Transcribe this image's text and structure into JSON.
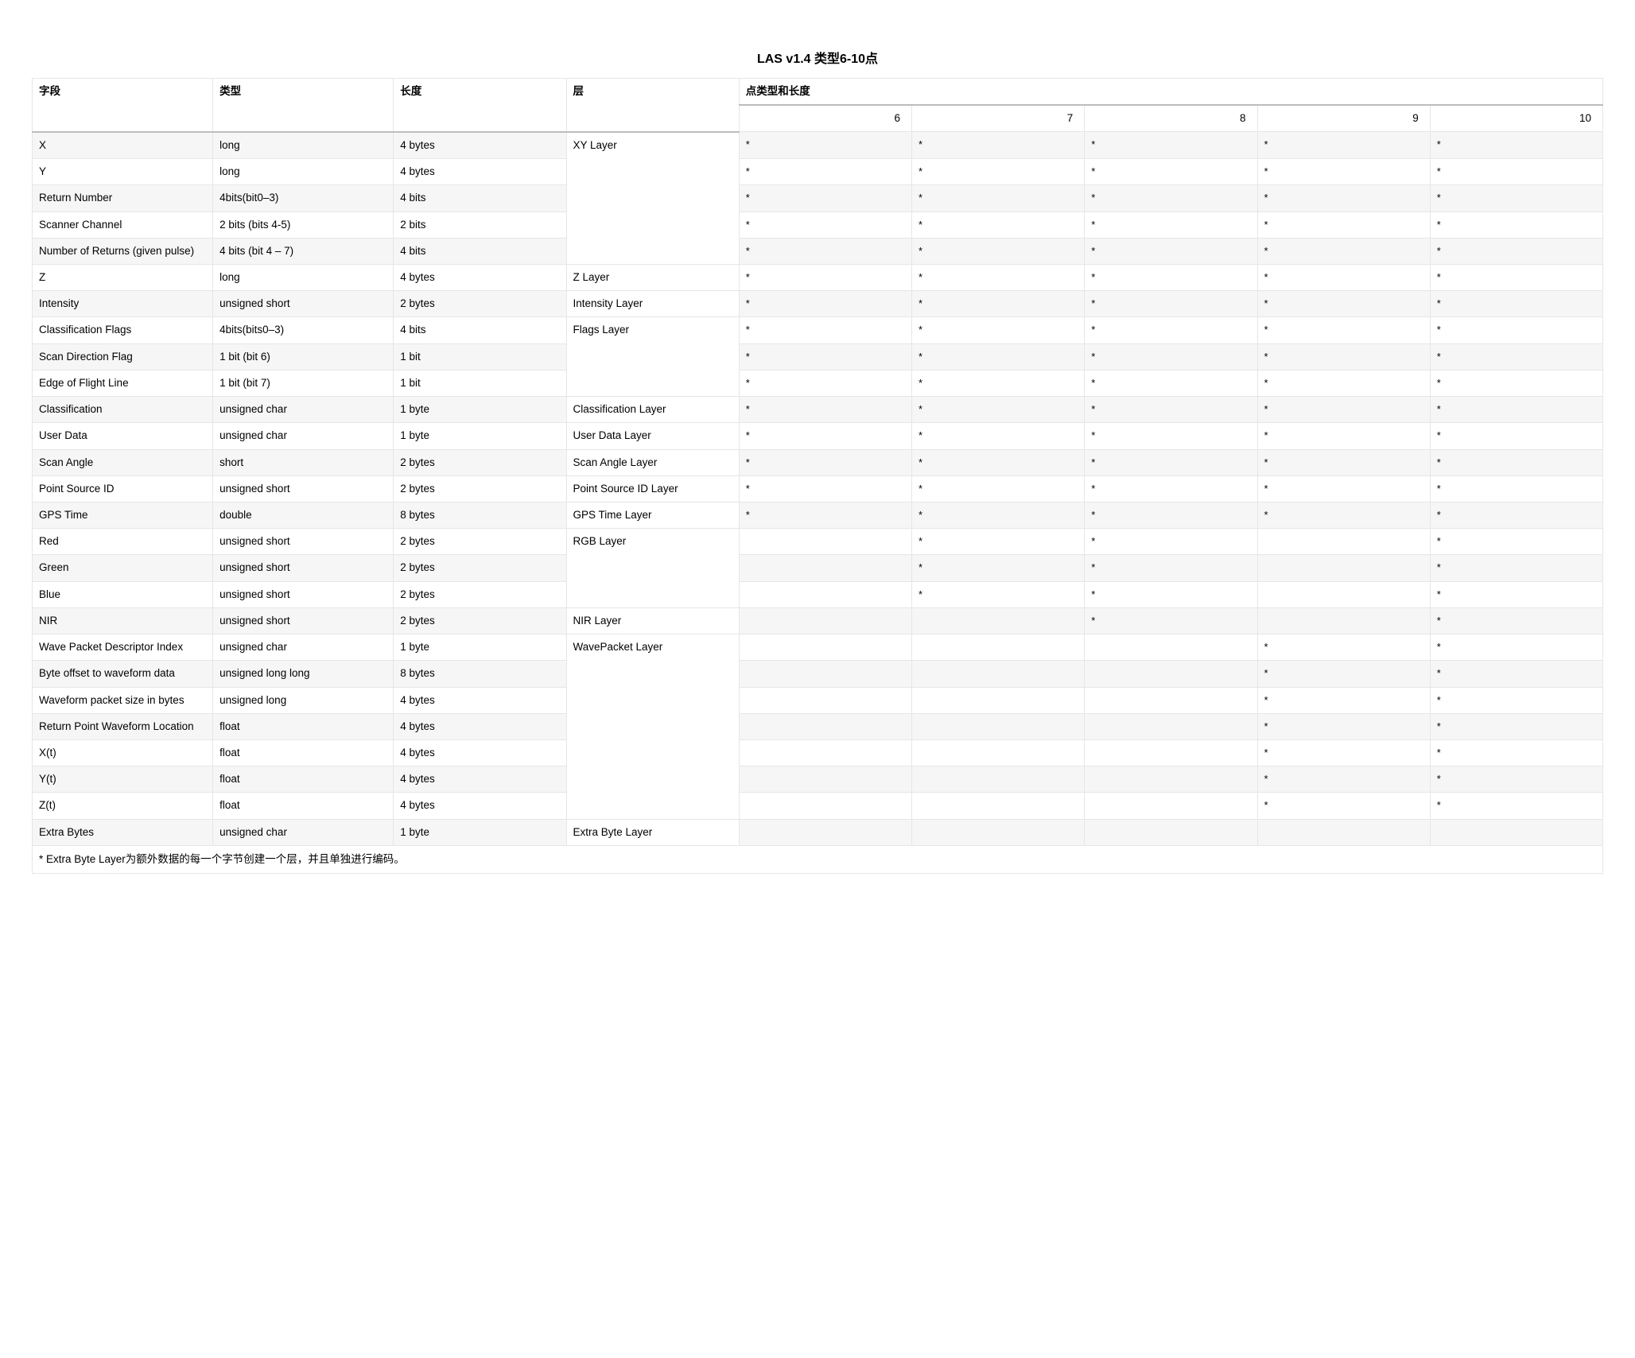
{
  "title": "LAS v1.4 类型6-10点",
  "headers": {
    "field": "字段",
    "type": "类型",
    "length": "长度",
    "layer": "层",
    "point_group": "点类型和长度"
  },
  "point_types": [
    "6",
    "7",
    "8",
    "9",
    "10"
  ],
  "layers": {
    "xy": "XY Layer",
    "z": "Z Layer",
    "intensity": "Intensity Layer",
    "flags": "Flags Layer",
    "classification": "Classification Layer",
    "userdata": "User Data Layer",
    "scanangle": "Scan Angle Layer",
    "pointsource": "Point Source ID Layer",
    "gpstime": "GPS Time Layer",
    "rgb": "RGB Layer",
    "nir": "NIR Layer",
    "wavepacket": "WavePacket Layer",
    "extrabyte": "Extra Byte Layer"
  },
  "rows": [
    {
      "field": "X",
      "type": "long",
      "length": "4 bytes",
      "layer_key": "xy",
      "layer_span": 5,
      "pts": [
        "*",
        "*",
        "*",
        "*",
        "*"
      ]
    },
    {
      "field": "Y",
      "type": "long",
      "length": "4 bytes",
      "pts": [
        "*",
        "*",
        "*",
        "*",
        "*"
      ]
    },
    {
      "field": "Return Number",
      "type": "4bits(bit0–3)",
      "length": "4 bits",
      "pts": [
        "*",
        "*",
        "*",
        "*",
        "*"
      ]
    },
    {
      "field": "Scanner Channel",
      "type": "2 bits (bits 4-5)",
      "length": "2 bits",
      "pts": [
        "*",
        "*",
        "*",
        "*",
        "*"
      ]
    },
    {
      "field": "Number of Returns (given pulse)",
      "type": "4 bits (bit 4 – 7)",
      "length": "4 bits",
      "pts": [
        "*",
        "*",
        "*",
        "*",
        "*"
      ]
    },
    {
      "field": "Z",
      "type": "long",
      "length": "4 bytes",
      "layer_key": "z",
      "layer_span": 1,
      "pts": [
        "*",
        "*",
        "*",
        "*",
        "*"
      ]
    },
    {
      "field": "Intensity",
      "type": "unsigned short",
      "length": "2 bytes",
      "layer_key": "intensity",
      "layer_span": 1,
      "pts": [
        "*",
        "*",
        "*",
        "*",
        "*"
      ]
    },
    {
      "field": "Classification Flags",
      "type": "4bits(bits0–3)",
      "length": "4 bits",
      "layer_key": "flags",
      "layer_span": 3,
      "pts": [
        "*",
        "*",
        "*",
        "*",
        "*"
      ]
    },
    {
      "field": "Scan Direction Flag",
      "type": "1 bit (bit 6)",
      "length": "1 bit",
      "pts": [
        "*",
        "*",
        "*",
        "*",
        "*"
      ]
    },
    {
      "field": "Edge of Flight Line",
      "type": "1 bit (bit 7)",
      "length": "1 bit",
      "pts": [
        "*",
        "*",
        "*",
        "*",
        "*"
      ]
    },
    {
      "field": "Classification",
      "type": "unsigned char",
      "length": "1 byte",
      "layer_key": "classification",
      "layer_span": 1,
      "pts": [
        "*",
        "*",
        "*",
        "*",
        "*"
      ]
    },
    {
      "field": "User Data",
      "type": "unsigned char",
      "length": "1 byte",
      "layer_key": "userdata",
      "layer_span": 1,
      "pts": [
        "*",
        "*",
        "*",
        "*",
        "*"
      ]
    },
    {
      "field": "Scan Angle",
      "type": "short",
      "length": "2 bytes",
      "layer_key": "scanangle",
      "layer_span": 1,
      "pts": [
        "*",
        "*",
        "*",
        "*",
        "*"
      ]
    },
    {
      "field": "Point Source ID",
      "type": "unsigned short",
      "length": "2 bytes",
      "layer_key": "pointsource",
      "layer_span": 1,
      "pts": [
        "*",
        "*",
        "*",
        "*",
        "*"
      ]
    },
    {
      "field": "GPS Time",
      "type": "double",
      "length": "8 bytes",
      "layer_key": "gpstime",
      "layer_span": 1,
      "pts": [
        "*",
        "*",
        "*",
        "*",
        "*"
      ]
    },
    {
      "field": "Red",
      "type": "unsigned short",
      "length": "2 bytes",
      "layer_key": "rgb",
      "layer_span": 3,
      "pts": [
        "",
        "*",
        "*",
        "",
        "*"
      ]
    },
    {
      "field": "Green",
      "type": "unsigned short",
      "length": "2 bytes",
      "pts": [
        "",
        "*",
        "*",
        "",
        "*"
      ]
    },
    {
      "field": "Blue",
      "type": "unsigned short",
      "length": "2 bytes",
      "pts": [
        "",
        "*",
        "*",
        "",
        "*"
      ]
    },
    {
      "field": "NIR",
      "type": "unsigned short",
      "length": "2 bytes",
      "layer_key": "nir",
      "layer_span": 1,
      "pts": [
        "",
        "",
        "*",
        "",
        "*"
      ]
    },
    {
      "field": "Wave Packet Descriptor Index",
      "type": "unsigned char",
      "length": "1 byte",
      "layer_key": "wavepacket",
      "layer_span": 7,
      "pts": [
        "",
        "",
        "",
        "*",
        "*"
      ]
    },
    {
      "field": "Byte offset to waveform data",
      "type": "unsigned long long",
      "length": "8 bytes",
      "pts": [
        "",
        "",
        "",
        "*",
        "*"
      ]
    },
    {
      "field": "Waveform packet size in bytes",
      "type": "unsigned long",
      "length": "4 bytes",
      "pts": [
        "",
        "",
        "",
        "*",
        "*"
      ]
    },
    {
      "field": "Return Point Waveform Location",
      "type": "float",
      "length": "4 bytes",
      "pts": [
        "",
        "",
        "",
        "*",
        "*"
      ]
    },
    {
      "field": "X(t)",
      "type": "float",
      "length": "4 bytes",
      "pts": [
        "",
        "",
        "",
        "*",
        "*"
      ]
    },
    {
      "field": "Y(t)",
      "type": "float",
      "length": "4 bytes",
      "pts": [
        "",
        "",
        "",
        "*",
        "*"
      ]
    },
    {
      "field": "Z(t)",
      "type": "float",
      "length": "4 bytes",
      "pts": [
        "",
        "",
        "",
        "*",
        "*"
      ]
    },
    {
      "field": "Extra Bytes",
      "type": "unsigned char",
      "length": "1 byte",
      "layer_key": "extrabyte",
      "layer_span": 1,
      "pts": [
        "",
        "",
        "",
        "",
        ""
      ]
    }
  ],
  "footnote": "* Extra Byte Layer为额外数据的每一个字节创建一个层，并且单独进行编码。"
}
